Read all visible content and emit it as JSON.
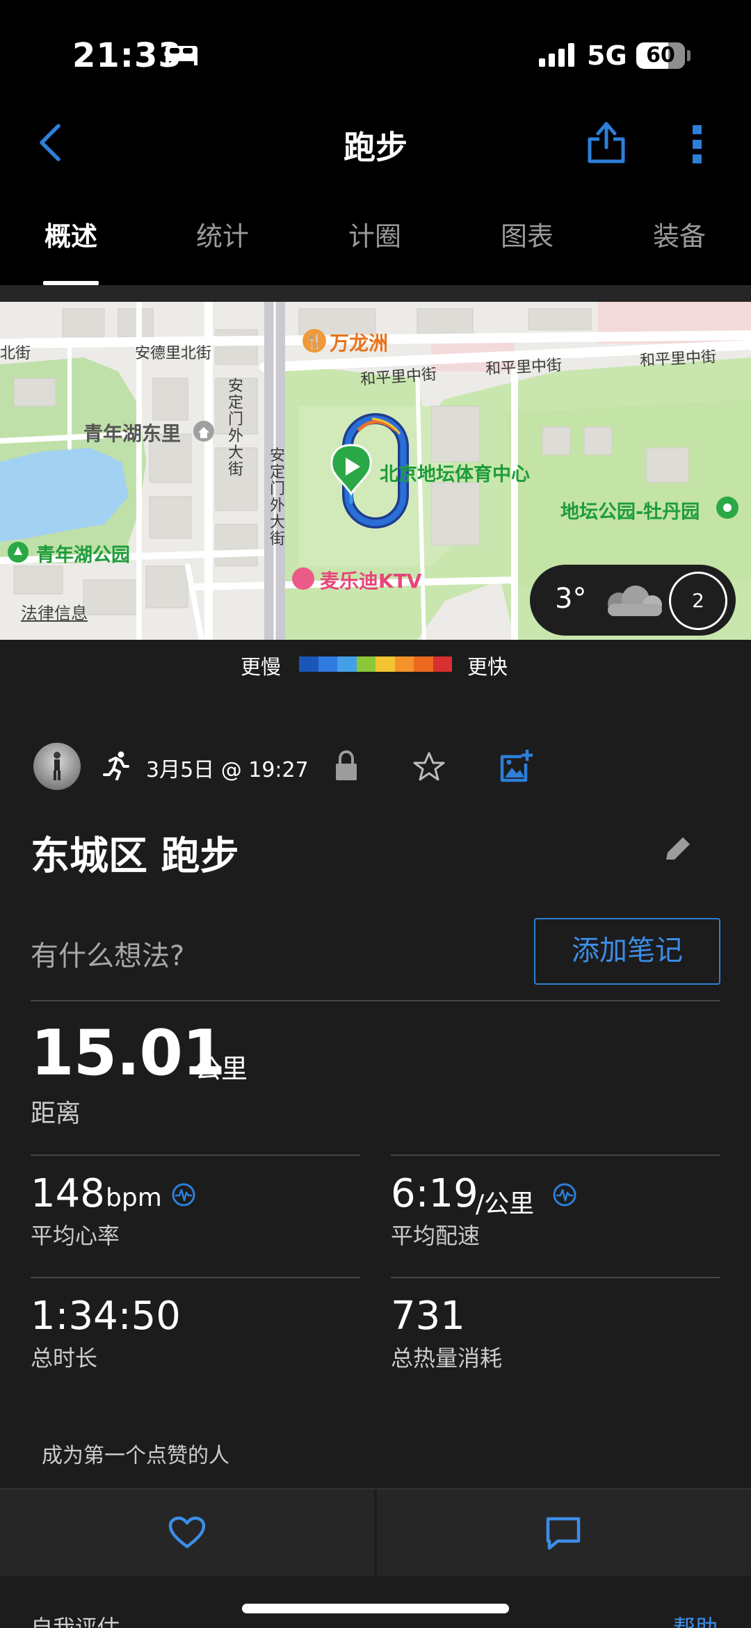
{
  "status_bar": {
    "time": "21:33",
    "network": "5G",
    "battery": "60",
    "icons": [
      "bed-icon",
      "signal-icon"
    ]
  },
  "nav": {
    "title": "跑步",
    "icons": [
      "back-chevron-icon",
      "share-icon",
      "more-vertical-icon"
    ],
    "accent_color": "#2d7fd8"
  },
  "tabs": [
    {
      "label": "概述",
      "active": true
    },
    {
      "label": "统计",
      "active": false
    },
    {
      "label": "计圈",
      "active": false
    },
    {
      "label": "图表",
      "active": false
    },
    {
      "label": "装备",
      "active": false
    }
  ],
  "map": {
    "labels": {
      "wanlongzhou": "万龙洲",
      "anding_street_1": "安定门外大街",
      "anding_street_2": "安定门外大街",
      "andeli": "安德里北街",
      "hepingli_1": "和平里中街",
      "hepingli_2": "和平里中街",
      "hepingli_3": "和平里中街",
      "qingnianhu_dongli": "青年湖东里",
      "ditan_center": "北京地坛体育中心",
      "ditan_park": "地坛公园-牡丹园",
      "qingnianhu_park": "青年湖公园",
      "karaoke": "麦乐迪KTV",
      "left_edge": "北街",
      "legal": "法律信息"
    },
    "weather": {
      "temperature": "3°",
      "wind": "2",
      "icon": "cloud-icon"
    }
  },
  "speed_legend": {
    "slow_label": "更慢",
    "fast_label": "更快",
    "colors": [
      "#1a56b8",
      "#2f7ae0",
      "#43a0e8",
      "#8ac83a",
      "#f2c531",
      "#f5922c",
      "#ec6a1e",
      "#d83030"
    ]
  },
  "activity": {
    "date": "3月5日 @ 19:27",
    "title": "东城区 跑步",
    "note_prompt": "有什么想法?",
    "note_button": "添加笔记",
    "icons": [
      "avatar",
      "running-icon",
      "lock-icon",
      "star-icon",
      "add-photo-icon",
      "edit-pencil-icon"
    ]
  },
  "stats": {
    "distance": {
      "value": "15.01",
      "unit": "公里",
      "label": "距离"
    },
    "heart_rate": {
      "value": "148",
      "unit": "bpm",
      "label": "平均心率"
    },
    "pace": {
      "value": "6:19",
      "unit": "/公里",
      "label": "平均配速"
    },
    "duration": {
      "value": "1:34:50",
      "label": "总时长"
    },
    "calories": {
      "value": "731",
      "label": "总热量消耗"
    }
  },
  "social": {
    "likes_text": "成为第一个点赞的人",
    "icons": [
      "heart-icon",
      "comment-icon"
    ]
  },
  "footer": {
    "self_eval": "自我评估",
    "help": "帮助"
  }
}
